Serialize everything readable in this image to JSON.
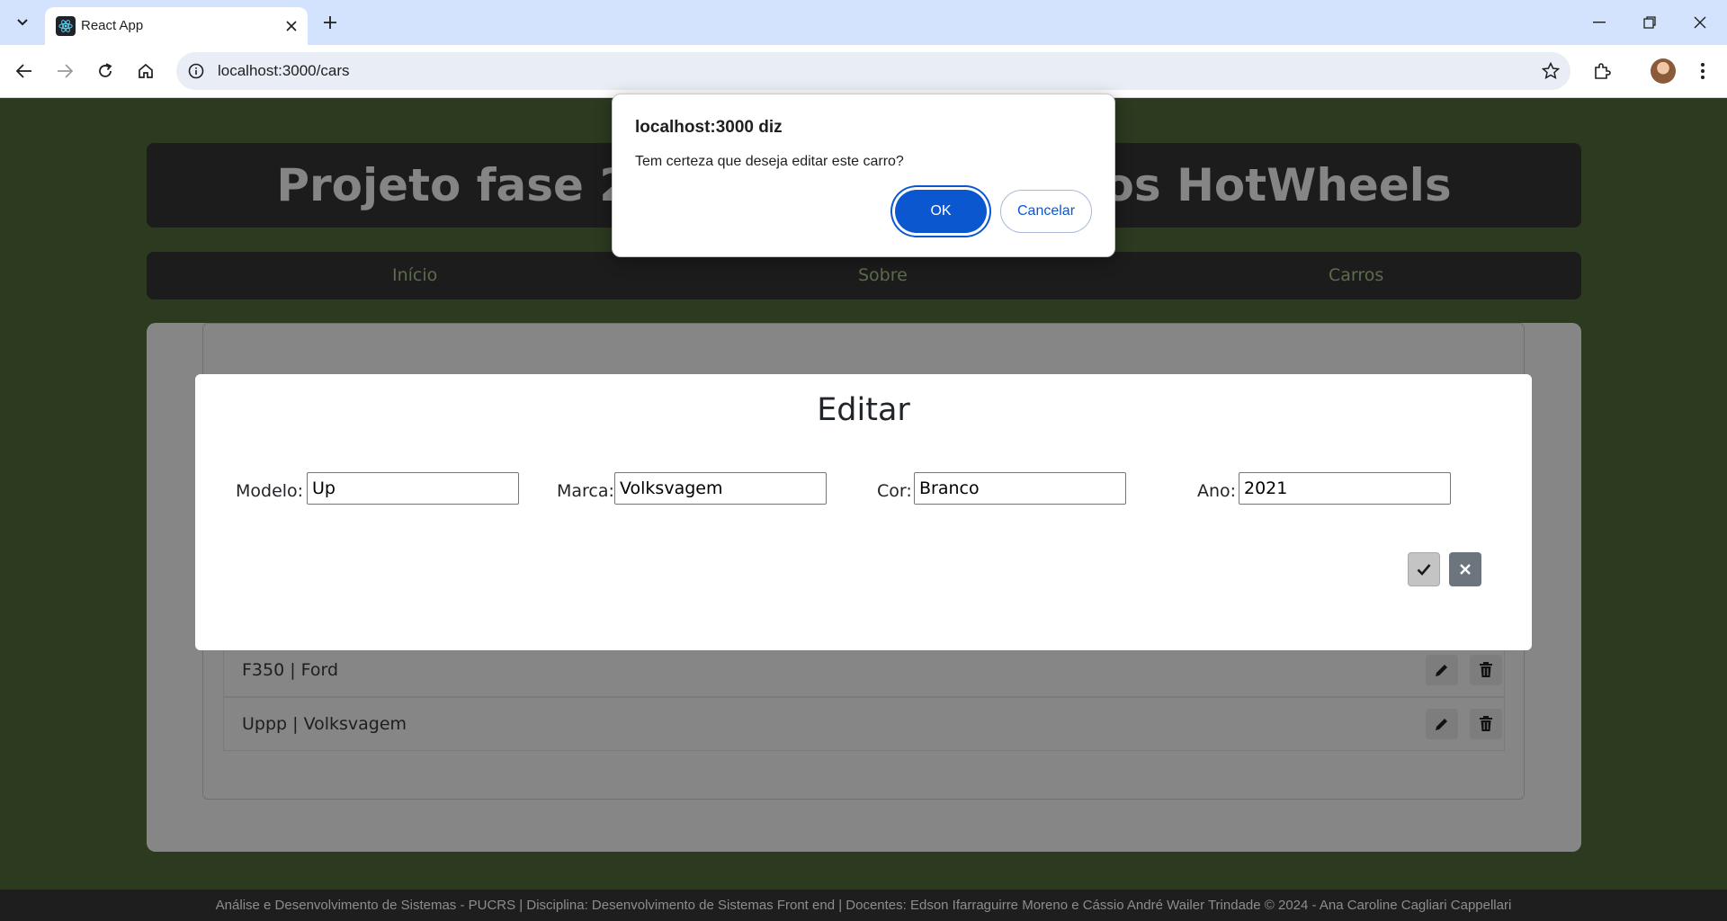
{
  "browser": {
    "tab_title": "React App",
    "url": "localhost:3000/cars"
  },
  "page": {
    "header_title": "Projeto fase 2 - CRUD de Carrinhos HotWheels",
    "nav": [
      "Início",
      "Sobre",
      "Carros"
    ],
    "car_list": [
      {
        "label": "F350 | Ford"
      },
      {
        "label": "Uppp | Volksvagem"
      }
    ],
    "footer": "Análise e Desenvolvimento de Sistemas - PUCRS | Disciplina: Desenvolvimento de Sistemas Front end | Docentes: Edson Ifarraguirre Moreno e Cássio André Wailer Trindade © 2024 - Ana Caroline Cagliari Cappellari"
  },
  "modal": {
    "title": "Editar",
    "fields": {
      "modelo": {
        "label": "Modelo:",
        "value": "Up"
      },
      "marca": {
        "label": "Marca:",
        "value": "Volksvagem"
      },
      "cor": {
        "label": "Cor:",
        "value": "Branco"
      },
      "ano": {
        "label": "Ano:",
        "value": "2021"
      }
    }
  },
  "dialog": {
    "title": "localhost:3000 diz",
    "message": "Tem certeza que deseja editar este carro?",
    "ok_label": "OK",
    "cancel_label": "Cancelar"
  },
  "colors": {
    "page_bg": "#2c3a20",
    "dialog_primary": "#0b57d0",
    "header_bg": "#1c1c1c"
  }
}
